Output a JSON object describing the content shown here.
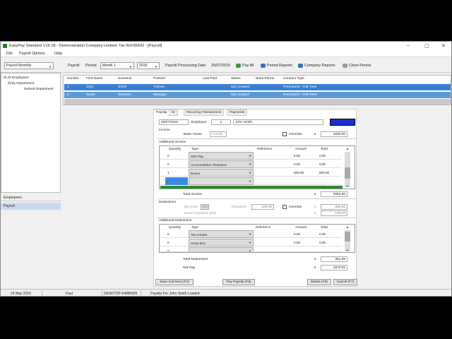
{
  "window": {
    "title": "EasyPay Standard V16.18 - Demonstration Company Limited, Tax Ref:65432 - [Payroll]",
    "min": "–",
    "max": "▢",
    "close": "✕"
  },
  "menu": [
    "File",
    "Payroll Options",
    "Help"
  ],
  "toolbar": {
    "payroll_select": "Payroll Monthly",
    "payroll_label": "Payroll",
    "period_label": "Period",
    "period_select": "Month 1",
    "year_select": "2015",
    "processing_label": "Payroll Processing Date",
    "processing_date": "25/07/2015",
    "pay_all": "Pay All",
    "period_reports": "Period Reports",
    "company_reports": "Company Reports",
    "close_period": "Close Period"
  },
  "tree": {
    "root": "All Employees",
    "child": "By Department",
    "leaf": "Default Department"
  },
  "nav": {
    "employees": "Employees",
    "payroll": "Payroll"
  },
  "grid": {
    "headers": [
      "Number",
      "First Name",
      "Surname",
      "Position",
      "Last Paid",
      "Status",
      "Work Phone",
      "Contract Type"
    ],
    "rows": [
      [
        "1",
        "John",
        "Smith",
        "Trainee",
        "",
        "Not Created",
        "",
        "Permanent : Full-Time"
      ],
      [
        "2",
        "Sarah",
        "Simpson",
        "Manager",
        "",
        "Not Created",
        "",
        "Permanent : Full-Time"
      ]
    ]
  },
  "tabs": [
    "Payslip",
    "SI",
    "Recurring Transactions",
    "Payments"
  ],
  "payslip": {
    "date": "25/07/2015",
    "employee_label": "Employee",
    "employee_no": "1",
    "employee_name": "John Smith"
  },
  "income": {
    "section": "Income",
    "basic_hours_label": "Basic Hours",
    "basic_hours": "173.33",
    "override_label": "Override",
    "currency": "£",
    "basic_amount": "1500.00"
  },
  "additional_income": {
    "section": "Additional Income",
    "headers": [
      "Quantity",
      "Type",
      "Reference",
      "Amount",
      "Total"
    ],
    "rows": [
      {
        "qty": "0",
        "type": "Sick Pay",
        "ref": "",
        "amount": "8.65",
        "total": "0.00"
      },
      {
        "qty": "0",
        "type": "Accomodation Allowance",
        "ref": "",
        "amount": "0.00",
        "total": "0.00"
      },
      {
        "qty": "1",
        "type": "Bonus",
        "ref": "",
        "amount": "500.00",
        "total": "500.00"
      }
    ],
    "total_label": "Total Income",
    "total": "2064.90"
  },
  "deductions": {
    "section": "Deductions",
    "tax_code_label": "Tax Code",
    "tax_code": "0.8",
    "allowance_label": "Allowance",
    "allowance": "233.00",
    "override_label": "Override",
    "tax": "282.82",
    "si_label": "Social Insurance (EE)",
    "si": "109.03"
  },
  "additional_deductions": {
    "section": "Additional Deductions",
    "headers": [
      "Quantity",
      "Type",
      "Reference",
      "Amount",
      "Total"
    ],
    "rows": [
      {
        "qty": "0",
        "type": "Tax Arrears",
        "ref": "",
        "amount": "0.00",
        "total": "0.00"
      },
      {
        "qty": "0",
        "type": "Xmas Box",
        "ref": "",
        "amount": "0.00",
        "total": "0.00"
      },
      {
        "qty": "0",
        "type": "",
        "ref": "",
        "amount": "",
        "total": ""
      }
    ],
    "total_label": "Total Deductions",
    "total": "391.85",
    "net_label": "Net Pay",
    "net": "1673.05"
  },
  "buttons": {
    "save_next": "Save And Next (F4)",
    "pay_payslip": "Pay Payslip (F8)",
    "delete": "Delete (F9)",
    "cancel": "Cancel (F7)"
  },
  "status": {
    "date": "24 May 2016",
    "user": "Paul",
    "machine": "DESKTOP-648BND8",
    "message": "Payslip For John Smith Loaded."
  },
  "colors": {
    "selected_row": "#3a7fd5",
    "highlight_box": "#1a2fd0",
    "green_bar": "#2e8b2e",
    "nav_selected": "#c9d9f0"
  }
}
